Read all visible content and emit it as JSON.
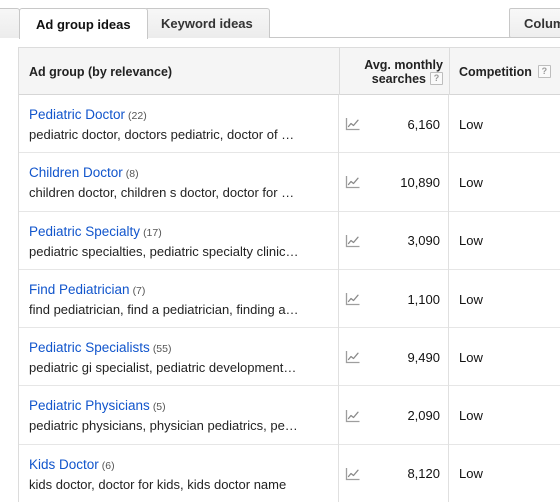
{
  "tabs": [
    {
      "label": "Ad group ideas",
      "active": true
    },
    {
      "label": "Keyword ideas",
      "active": false
    }
  ],
  "toolbar": {
    "columns_label": "Columns"
  },
  "colors": {
    "link": "#1155cc",
    "header_bg": "#f5f5f5",
    "border": "#dcdcdc",
    "text": "#222222"
  },
  "table": {
    "columns": [
      {
        "key": "ad_group",
        "label": "Ad group (by relevance)",
        "help": false
      },
      {
        "key": "avg_monthly_searches",
        "label_line1": "Avg. monthly",
        "label_line2": "searches",
        "help": true,
        "help_glyph": "?"
      },
      {
        "key": "competition",
        "label": "Competition",
        "help": true,
        "help_glyph": "?"
      }
    ],
    "rows": [
      {
        "name": "Pediatric Doctor",
        "count": "(22)",
        "keywords": "pediatric doctor, doctors pediatric, doctor of …",
        "avg_monthly_searches": "6,160",
        "competition": "Low",
        "trend_icon": "line-chart-icon"
      },
      {
        "name": "Children Doctor",
        "count": "(8)",
        "keywords": "children doctor, children s doctor, doctor for …",
        "avg_monthly_searches": "10,890",
        "competition": "Low",
        "trend_icon": "line-chart-icon"
      },
      {
        "name": "Pediatric Specialty",
        "count": "(17)",
        "keywords": "pediatric specialties, pediatric specialty clinic…",
        "avg_monthly_searches": "3,090",
        "competition": "Low",
        "trend_icon": "line-chart-icon"
      },
      {
        "name": "Find Pediatrician",
        "count": "(7)",
        "keywords": "find pediatrician, find a pediatrician, finding a…",
        "avg_monthly_searches": "1,100",
        "competition": "Low",
        "trend_icon": "line-chart-icon"
      },
      {
        "name": "Pediatric Specialists",
        "count": "(55)",
        "keywords": "pediatric gi specialist, pediatric development…",
        "avg_monthly_searches": "9,490",
        "competition": "Low",
        "trend_icon": "line-chart-icon"
      },
      {
        "name": "Pediatric Physicians",
        "count": "(5)",
        "keywords": "pediatric physicians, physician pediatrics, pe…",
        "avg_monthly_searches": "2,090",
        "competition": "Low",
        "trend_icon": "line-chart-icon"
      },
      {
        "name": "Kids Doctor",
        "count": "(6)",
        "keywords": "kids doctor, doctor for kids, kids doctor name",
        "avg_monthly_searches": "8,120",
        "competition": "Low",
        "trend_icon": "line-chart-icon"
      }
    ]
  }
}
